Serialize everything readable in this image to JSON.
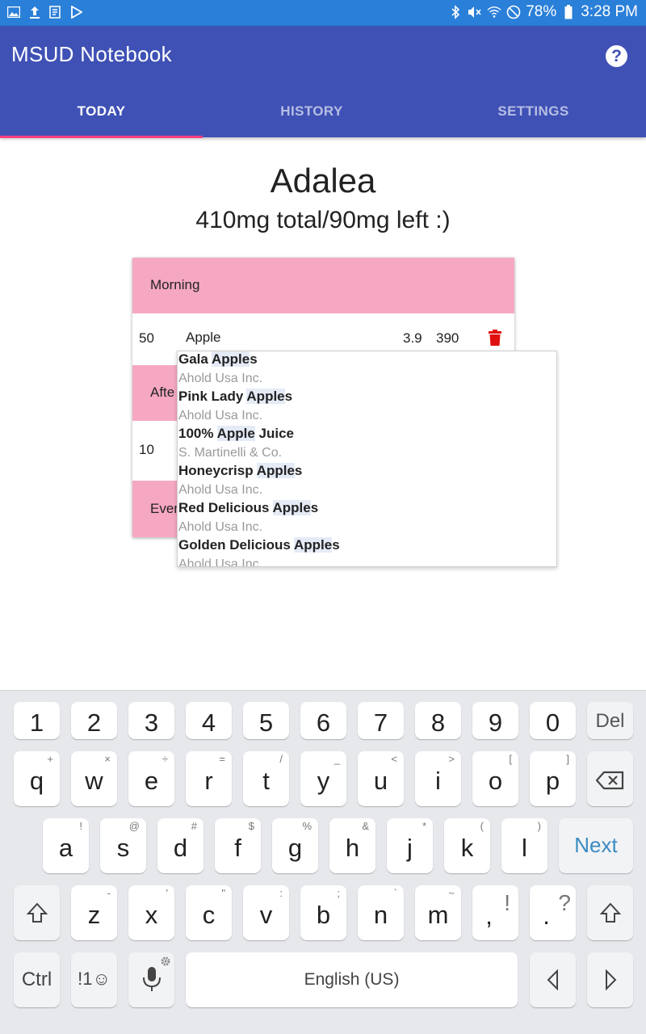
{
  "status_bar": {
    "battery": "78%",
    "time": "3:28 PM"
  },
  "app": {
    "title": "MSUD Notebook",
    "help_label": "?"
  },
  "tabs": [
    {
      "label": "TODAY",
      "active": true
    },
    {
      "label": "HISTORY",
      "active": false
    },
    {
      "label": "SETTINGS",
      "active": false
    }
  ],
  "person": {
    "name": "Adalea",
    "summary": "410mg total/90mg left :)"
  },
  "meals": {
    "morning_label": "Morning",
    "afternoon_label": "Afte",
    "evening_label": "Even",
    "rows": [
      {
        "amount": "50",
        "food": "Apple",
        "factor": "3.9",
        "mg": "390"
      },
      {
        "amount": "10"
      }
    ]
  },
  "suggestions": [
    {
      "pre": "Gala ",
      "hl": "Apple",
      "post": "s",
      "brand": "Ahold Usa Inc."
    },
    {
      "pre": "Pink Lady ",
      "hl": "Apple",
      "post": "s",
      "brand": "Ahold Usa Inc."
    },
    {
      "pre": "100% ",
      "hl": "Apple",
      "post": " Juice",
      "brand": "S. Martinelli & Co."
    },
    {
      "pre": "Honeycrisp ",
      "hl": "Apple",
      "post": "s",
      "brand": "Ahold Usa Inc."
    },
    {
      "pre": "Red Delicious ",
      "hl": "Apple",
      "post": "s",
      "brand": "Ahold Usa Inc."
    },
    {
      "pre": "Golden Delicious ",
      "hl": "Apple",
      "post": "s",
      "brand": "Ahold Usa Inc."
    }
  ],
  "keyboard": {
    "numbers": [
      "1",
      "2",
      "3",
      "4",
      "5",
      "6",
      "7",
      "8",
      "9",
      "0"
    ],
    "del": "Del",
    "row1": [
      {
        "k": "q",
        "s": "+"
      },
      {
        "k": "w",
        "s": "×"
      },
      {
        "k": "e",
        "s": "÷"
      },
      {
        "k": "r",
        "s": "="
      },
      {
        "k": "t",
        "s": "/"
      },
      {
        "k": "y",
        "s": "_"
      },
      {
        "k": "u",
        "s": "<"
      },
      {
        "k": "i",
        "s": ">"
      },
      {
        "k": "o",
        "s": "["
      },
      {
        "k": "p",
        "s": "]"
      }
    ],
    "row2": [
      {
        "k": "a",
        "s": "!"
      },
      {
        "k": "s",
        "s": "@"
      },
      {
        "k": "d",
        "s": "#"
      },
      {
        "k": "f",
        "s": "$"
      },
      {
        "k": "g",
        "s": "%"
      },
      {
        "k": "h",
        "s": "&"
      },
      {
        "k": "j",
        "s": "*"
      },
      {
        "k": "k",
        "s": "("
      },
      {
        "k": "l",
        "s": ")"
      }
    ],
    "next": "Next",
    "row3": [
      {
        "k": "z",
        "s": "-"
      },
      {
        "k": "x",
        "s": "'"
      },
      {
        "k": "c",
        "s": "\""
      },
      {
        "k": "v",
        "s": ":"
      },
      {
        "k": "b",
        "s": ";"
      },
      {
        "k": "n",
        "s": "`"
      },
      {
        "k": "m",
        "s": "~"
      }
    ],
    "comma": ",",
    "comma_sub": "!",
    "period": ".",
    "period_sub": "?",
    "ctrl": "Ctrl",
    "sym": "!1☺",
    "space": "English (US)"
  }
}
